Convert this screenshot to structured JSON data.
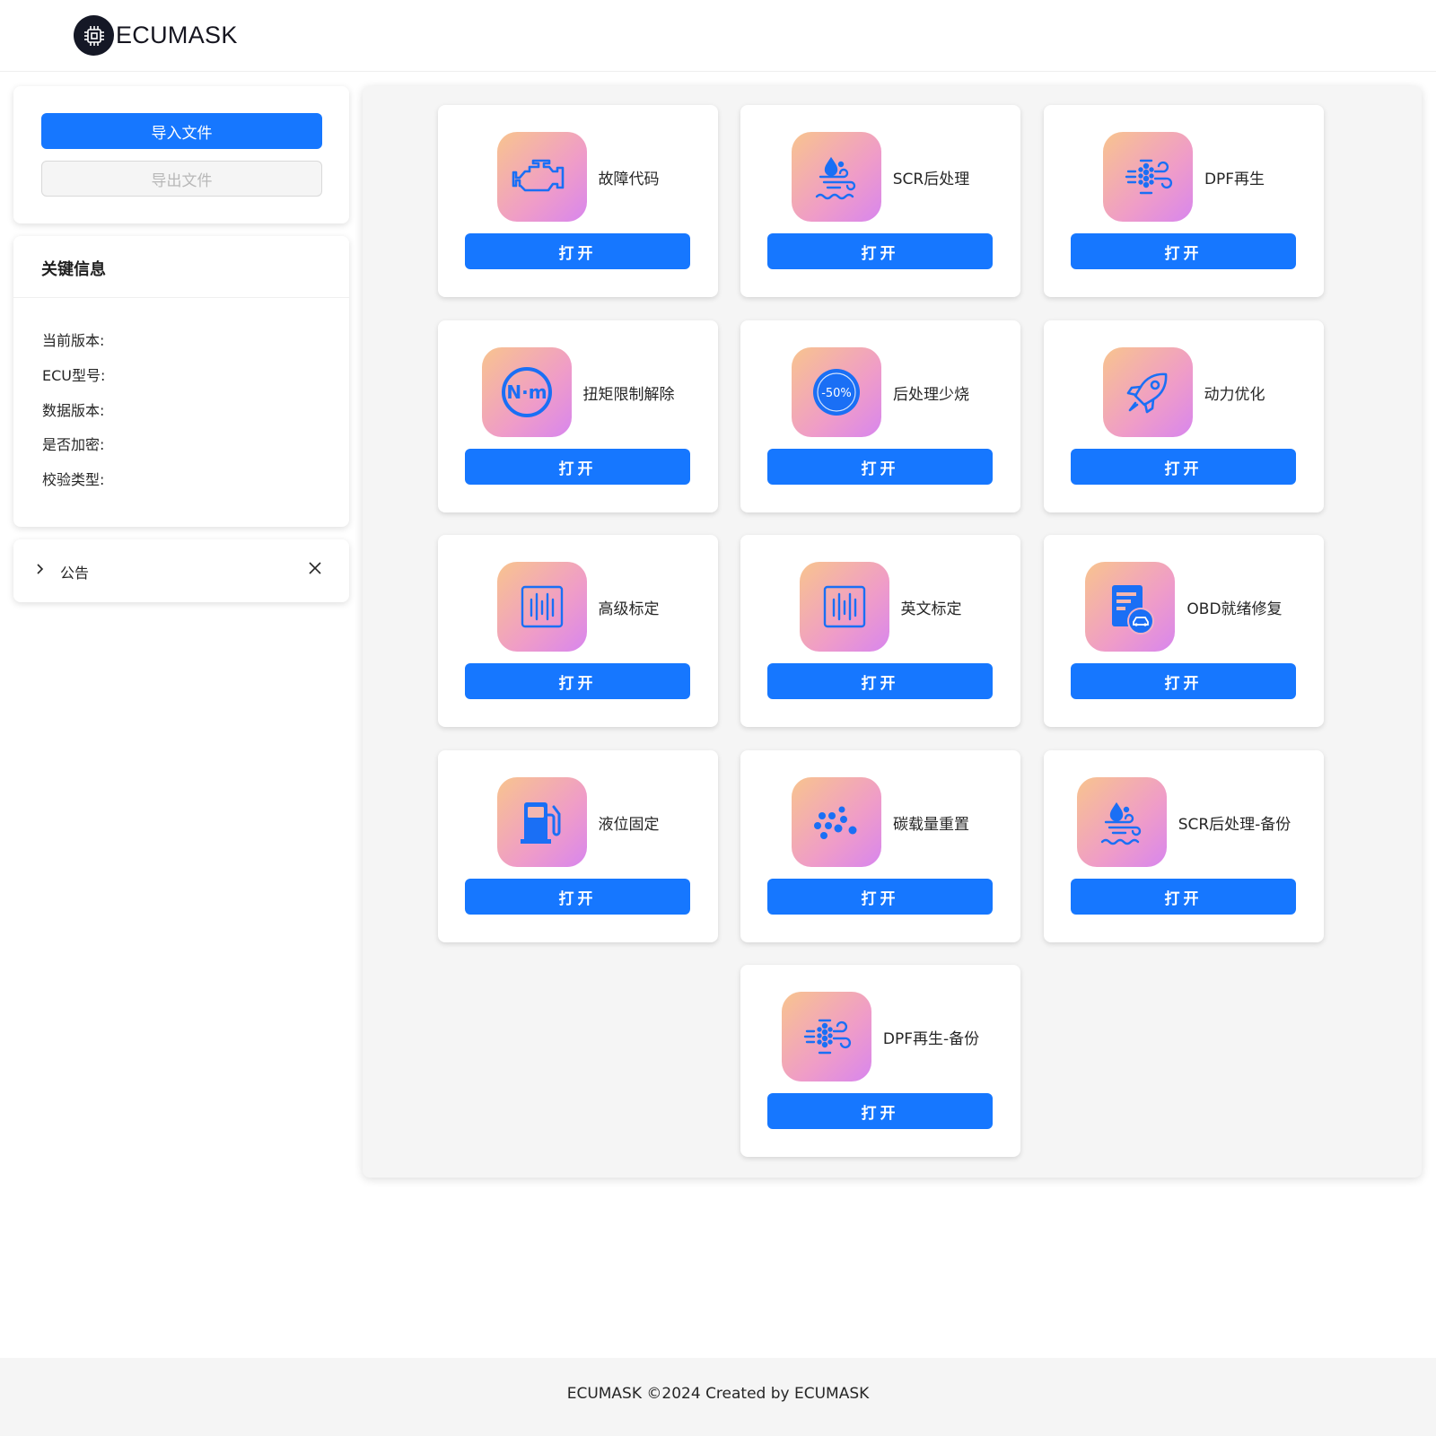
{
  "header": {
    "logo_text": "ECUMASK",
    "logo_icon": "cpu-chip-icon"
  },
  "file_panel": {
    "import_label": "导入文件",
    "export_label": "导出文件"
  },
  "info_panel": {
    "title": "关键信息",
    "rows": [
      {
        "label": "当前版本:",
        "value": ""
      },
      {
        "label": "ECU型号:",
        "value": ""
      },
      {
        "label": "数据版本:",
        "value": ""
      },
      {
        "label": "是否加密:",
        "value": ""
      },
      {
        "label": "校验类型:",
        "value": ""
      }
    ]
  },
  "notice": {
    "label": "公告"
  },
  "tiles": [
    {
      "label": "故障代码",
      "icon": "engine-icon",
      "button": "打开"
    },
    {
      "label": "SCR后处理",
      "icon": "scr-fluid-icon",
      "button": "打开"
    },
    {
      "label": "DPF再生",
      "icon": "dpf-filter-icon",
      "button": "打开"
    },
    {
      "label": "扭矩限制解除",
      "icon": "torque-nm-icon",
      "button": "打开"
    },
    {
      "label": "后处理少烧",
      "icon": "minus-50-percent-icon",
      "nm_text": "N·m",
      "badge_text": "-50%",
      "button": "打开"
    },
    {
      "label": "动力优化",
      "icon": "rocket-icon",
      "button": "打开"
    },
    {
      "label": "高级标定",
      "icon": "calibration-bars-icon",
      "button": "打开"
    },
    {
      "label": "英文标定",
      "icon": "calibration-bars-icon",
      "button": "打开"
    },
    {
      "label": "OBD就绪修复",
      "icon": "obd-report-icon",
      "button": "打开"
    },
    {
      "label": "液位固定",
      "icon": "fuel-pump-icon",
      "button": "打开"
    },
    {
      "label": "碳载量重置",
      "icon": "carbon-dots-icon",
      "button": "打开"
    },
    {
      "label": "SCR后处理-备份",
      "icon": "scr-fluid-icon",
      "button": "打开"
    },
    {
      "label": "DPF再生-备份",
      "icon": "dpf-filter-icon",
      "button": "打开"
    }
  ],
  "footer": {
    "text": "ECUMASK ©2024 Created by ECUMASK"
  },
  "colors": {
    "primary": "#1677ff",
    "icon_blue": "#1a6ff5",
    "panel_bg": "#f5f5f5"
  }
}
